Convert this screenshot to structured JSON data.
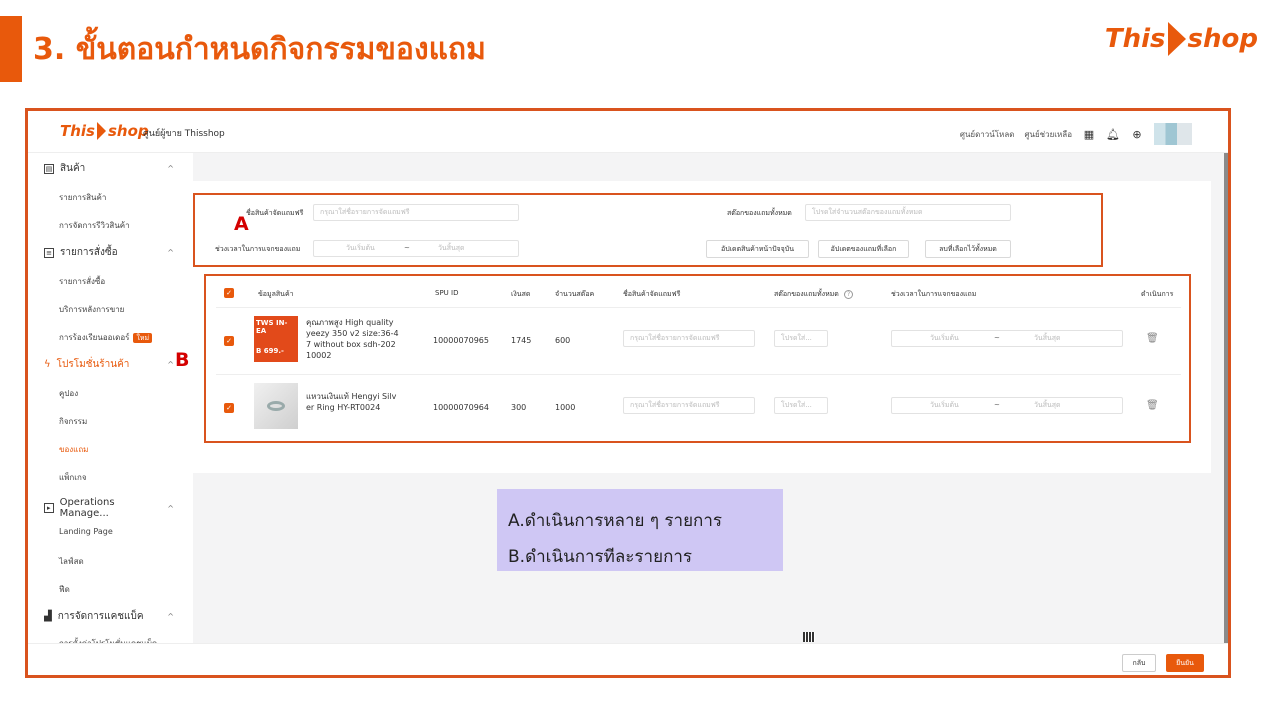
{
  "slide": {
    "title": "3. ขั้นตอนกำหนดกิจกรรมของแถม",
    "brand_this": "This",
    "brand_shop": "shop"
  },
  "topbar": {
    "logo_this": "This",
    "logo_shop": "shop",
    "seller_center": "ศูนย์ผู้ขาย Thisshop",
    "download_center": "ศูนย์ดาวน์โหลด",
    "help_center": "ศูนย์ช่วยเหลือ"
  },
  "sidebar": {
    "groups": [
      {
        "label": "สินค้า",
        "items": [
          "รายการสินค้า",
          "การจัดการรีวิวสินค้า"
        ]
      },
      {
        "label": "รายการสั่งซื้อ",
        "items": [
          "รายการสั่งซื้อ",
          "บริการหลังการขาย",
          "การร้องเรียนออเดอร์"
        ]
      },
      {
        "label": "โปรโมชั่นร้านค้า",
        "items": [
          "คูปอง",
          "กิจกรรม",
          "ของแถม",
          "แพ็กเกจ"
        ]
      },
      {
        "label": "Operations Manage...",
        "items": [
          "Landing Page",
          "ไลฟ์สด",
          "ฟีด"
        ]
      },
      {
        "label": "การจัดการแคชแบ็ค",
        "items": [
          "การตั้งค่าโปรโมชั่นแคชแบ็ค"
        ]
      }
    ],
    "new_badge": "ใหม่"
  },
  "form": {
    "gift_name_label": "ชื่อสินค้าจัดแถมฟรี",
    "gift_name_placeholder": "กรุณาใส่ชื่อรายการจัดแถมฟรี",
    "total_stock_label": "สต๊อกของแถมทั้งหมด",
    "total_stock_placeholder": "โปรดใส่จำนวนสต๊อกของแถมทั้งหมด",
    "period_label": "ช่วงเวลาในการแจกของแถม",
    "start_placeholder": "วันเริ่มต้น",
    "range_sep": "~",
    "end_placeholder": "วันสิ้นสุด",
    "btn_update_current": "อัปเดตสินค้าหน้าปัจจุบัน",
    "btn_update_selected": "อัปเดตของแถมที่เลือก",
    "btn_delete_all": "ลบที่เลือกไว้ทั้งหมด"
  },
  "table": {
    "headers": [
      "ข้อมูลสินค้า",
      "SPU ID",
      "เงินสด",
      "จำนวนสต๊อค",
      "ชื่อสินค้าจัดแถมฟรี",
      "สต๊อกของแถมทั้งหมด",
      "ช่วงเวลาในการแจกของแถม",
      "ดำเนินการ"
    ],
    "rows": [
      {
        "name": "คุณภาพสูง High quality yeezy 350 v2 size:36-47 without box sdh-20210002",
        "name_lines": [
          "คุณภาพสูง High quality",
          "yeezy 350 v2 size:36-4",
          "7 without box sdh-202",
          "10002"
        ],
        "thumb_text1": "TWS IN-EA",
        "thumb_text2": "B 699.-",
        "spu": "10000070965",
        "cash": "1745",
        "stock": "600",
        "gift_placeholder": "กรุณาใส่ชื่อรายการจัดแถมฟรี",
        "stock_placeholder": "โปรดใส่...",
        "start": "วันเริ่มต้น",
        "end": "วันสิ้นสุด"
      },
      {
        "name": "แหวนเงินแท้ Hengyi Silver Ring HY-RT0024",
        "name_lines": [
          "แหวนเงินแท้ Hengyi Silv",
          "er Ring HY-RT0024"
        ],
        "spu": "10000070964",
        "cash": "300",
        "stock": "1000",
        "gift_placeholder": "กรุณาใส่ชื่อรายการจัดแถมฟรี",
        "stock_placeholder": "โปรดใส่...",
        "start": "วันเริ่มต้น",
        "end": "วันสิ้นสุด"
      }
    ]
  },
  "annotations": {
    "letter_a": "A",
    "letter_b": "B",
    "legend_a": "A.ดำเนินการหลาย ๆ รายการ",
    "legend_b": "B.ดำเนินการทีละรายการ"
  },
  "footer": {
    "back": "กลับ",
    "save": "ยืนยัน"
  },
  "colors": {
    "brand_orange": "#e8590c",
    "annotation_red": "#d40000",
    "legend_bg": "#cfc7f4"
  }
}
